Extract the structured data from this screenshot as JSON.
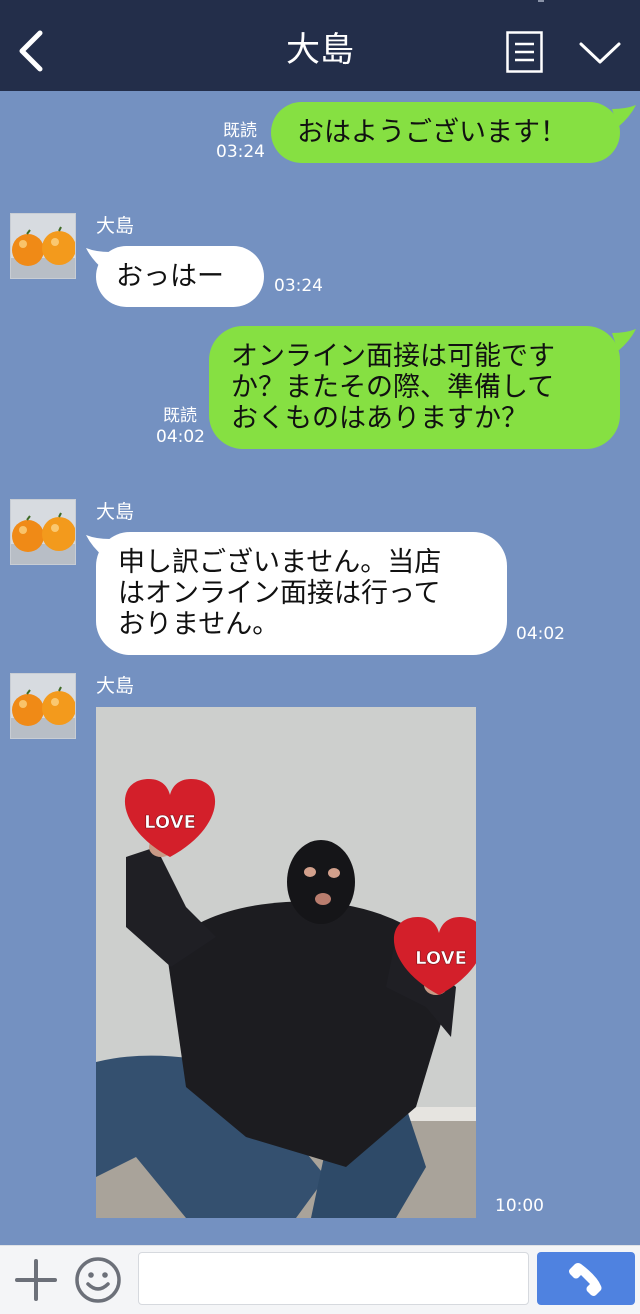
{
  "header": {
    "title": "大島"
  },
  "messages": [
    {
      "from": "me",
      "text": "おはようございます！",
      "read": "既読",
      "time": "03:24"
    },
    {
      "from": "them",
      "sender": "大島",
      "text": "おっはー",
      "time": "03:24"
    },
    {
      "from": "me",
      "lines": [
        "オンライン面接は可能です",
        "か？またその際、準備して",
        "おくものはありますか？"
      ],
      "read": "既読",
      "time": "04:02"
    },
    {
      "from": "them",
      "sender": "大島",
      "lines": [
        "申し訳ございません。当店",
        "はオンライン面接は行って",
        "おりません。"
      ],
      "time": "04:02"
    },
    {
      "from": "them",
      "sender": "大島",
      "image": {
        "labels": [
          "LOVE",
          "LOVE"
        ]
      },
      "time": "10:00"
    }
  ],
  "footer": {
    "input_value": "",
    "input_placeholder": ""
  },
  "colors": {
    "header_bg": "#232e4a",
    "chat_bg": "#7491c1",
    "my_bubble": "#86e042",
    "their_bubble": "#ffffff",
    "call_button": "#4f82e0"
  },
  "icons": [
    "back-arrow-icon",
    "menu-list-icon",
    "chevron-down-icon",
    "plus-icon",
    "smiley-icon",
    "phone-icon"
  ]
}
